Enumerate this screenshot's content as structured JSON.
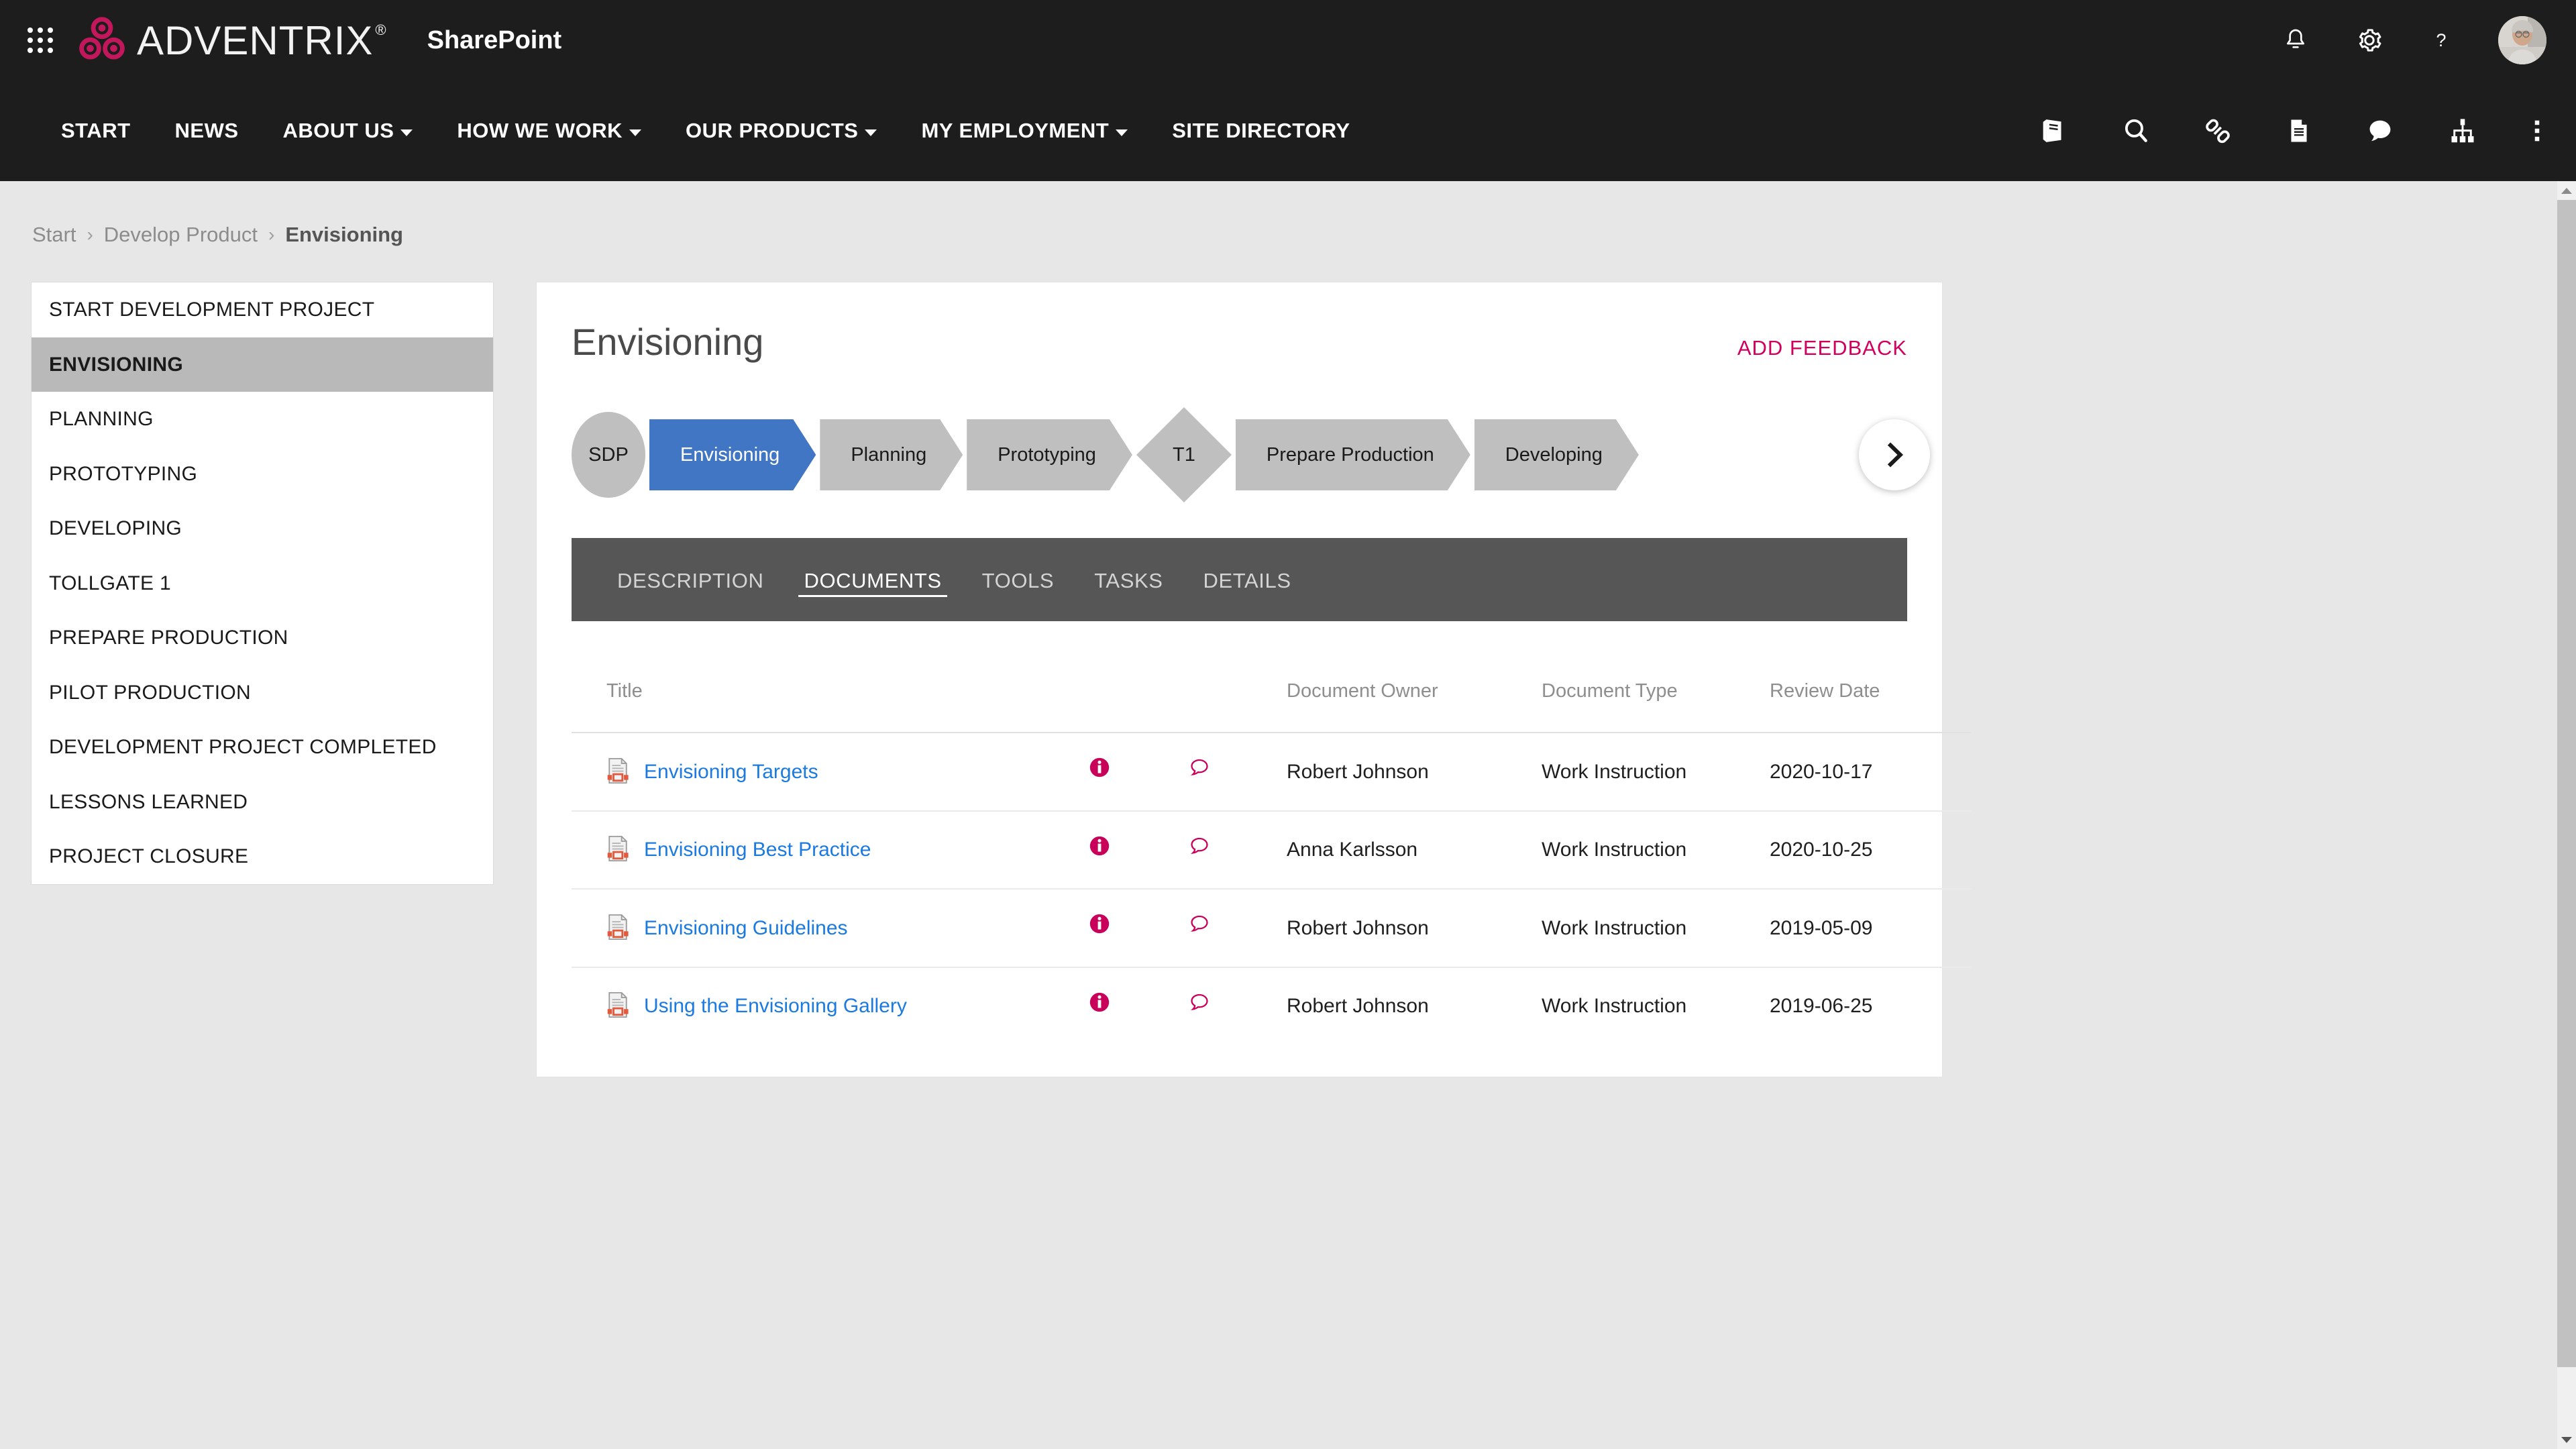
{
  "brand": {
    "waffle_icon": "app-launcher-icon",
    "logo_icon": "adventrix-trefoil-logo",
    "logo_text": "ADVENTRIX",
    "registered_mark": "®",
    "product_name": "SharePoint",
    "accent_color": "#d1005d",
    "bar_color": "#1d1d1d",
    "right_icons": [
      {
        "name": "notifications-bell-icon",
        "label": "Notifications"
      },
      {
        "name": "settings-gear-icon",
        "label": "Settings"
      },
      {
        "name": "help-question-icon",
        "label": "Help"
      }
    ],
    "avatar_label": "User profile photo"
  },
  "nav": {
    "items": [
      {
        "label": "START",
        "has_dropdown": false
      },
      {
        "label": "NEWS",
        "has_dropdown": false
      },
      {
        "label": "ABOUT US",
        "has_dropdown": true
      },
      {
        "label": "HOW WE WORK",
        "has_dropdown": true
      },
      {
        "label": "OUR PRODUCTS",
        "has_dropdown": true
      },
      {
        "label": "MY EMPLOYMENT",
        "has_dropdown": true
      },
      {
        "label": "SITE DIRECTORY",
        "has_dropdown": false
      }
    ],
    "tool_icons": [
      {
        "name": "book-icon",
        "label": "Handbook"
      },
      {
        "name": "search-icon",
        "label": "Search"
      },
      {
        "name": "link-icon",
        "label": "Links"
      },
      {
        "name": "document-icon",
        "label": "Documents"
      },
      {
        "name": "chat-bubble-icon",
        "label": "Chat"
      },
      {
        "name": "sitemap-icon",
        "label": "Site map"
      },
      {
        "name": "more-vertical-icon",
        "label": "More"
      }
    ]
  },
  "breadcrumb": {
    "items": [
      "Start",
      "Develop Product"
    ],
    "separator": "›",
    "current": "Envisioning"
  },
  "sidebar": {
    "items": [
      {
        "label": "START DEVELOPMENT PROJECT",
        "active": false
      },
      {
        "label": "ENVISIONING",
        "active": true
      },
      {
        "label": "PLANNING",
        "active": false
      },
      {
        "label": "PROTOTYPING",
        "active": false
      },
      {
        "label": "DEVELOPING",
        "active": false
      },
      {
        "label": "TOLLGATE 1",
        "active": false
      },
      {
        "label": "PREPARE PRODUCTION",
        "active": false
      },
      {
        "label": "PILOT PRODUCTION",
        "active": false
      },
      {
        "label": "DEVELOPMENT PROJECT COMPLETED",
        "active": false
      },
      {
        "label": "LESSONS LEARNED",
        "active": false
      },
      {
        "label": "PROJECT CLOSURE",
        "active": false
      }
    ]
  },
  "main": {
    "title": "Envisioning",
    "add_feedback_label": "ADD FEEDBACK",
    "flow": {
      "next_arrow_icon": "chevron-right-icon",
      "active_color": "#4176c4",
      "inactive_color": "#bfbfbf",
      "steps": [
        {
          "label": "SDP",
          "shape": "oval",
          "active": false
        },
        {
          "label": "Envisioning",
          "shape": "chevron",
          "active": true
        },
        {
          "label": "Planning",
          "shape": "chevron",
          "active": false
        },
        {
          "label": "Prototyping",
          "shape": "chevron",
          "active": false
        },
        {
          "label": "T1",
          "shape": "diamond",
          "active": false
        },
        {
          "label": "Prepare Production",
          "shape": "chevron",
          "active": false
        },
        {
          "label": "Developing",
          "shape": "chevron",
          "active": false
        }
      ]
    },
    "tabs": [
      {
        "label": "DESCRIPTION",
        "active": false
      },
      {
        "label": "DOCUMENTS",
        "active": true
      },
      {
        "label": "TOOLS",
        "active": false
      },
      {
        "label": "TASKS",
        "active": false
      },
      {
        "label": "DETAILS",
        "active": false
      }
    ],
    "documents_table": {
      "columns": [
        "Title",
        "",
        "",
        "Document Owner",
        "Document Type",
        "Review Date"
      ],
      "rows": [
        {
          "title": "Envisioning Targets",
          "file_icon": "document-file-icon",
          "info_icon": "info-circle-icon",
          "comment_icon": "comment-bubble-icon",
          "owner": "Robert Johnson",
          "type": "Work Instruction",
          "review_date": "2020-10-17"
        },
        {
          "title": "Envisioning Best Practice",
          "file_icon": "document-file-icon",
          "info_icon": "info-circle-icon",
          "comment_icon": "comment-bubble-icon",
          "owner": "Anna Karlsson",
          "type": "Work Instruction",
          "review_date": "2020-10-25"
        },
        {
          "title": "Envisioning Guidelines",
          "file_icon": "document-file-icon",
          "info_icon": "info-circle-icon",
          "comment_icon": "comment-bubble-icon",
          "owner": "Robert Johnson",
          "type": "Work Instruction",
          "review_date": "2019-05-09"
        },
        {
          "title": "Using the Envisioning Gallery",
          "file_icon": "document-file-icon",
          "info_icon": "info-circle-icon",
          "comment_icon": "comment-bubble-icon",
          "owner": "Robert Johnson",
          "type": "Work Instruction",
          "review_date": "2019-06-25"
        }
      ]
    }
  },
  "scrollbar": {
    "up_icon": "scroll-up-arrow-icon",
    "down_icon": "scroll-down-arrow-icon"
  }
}
